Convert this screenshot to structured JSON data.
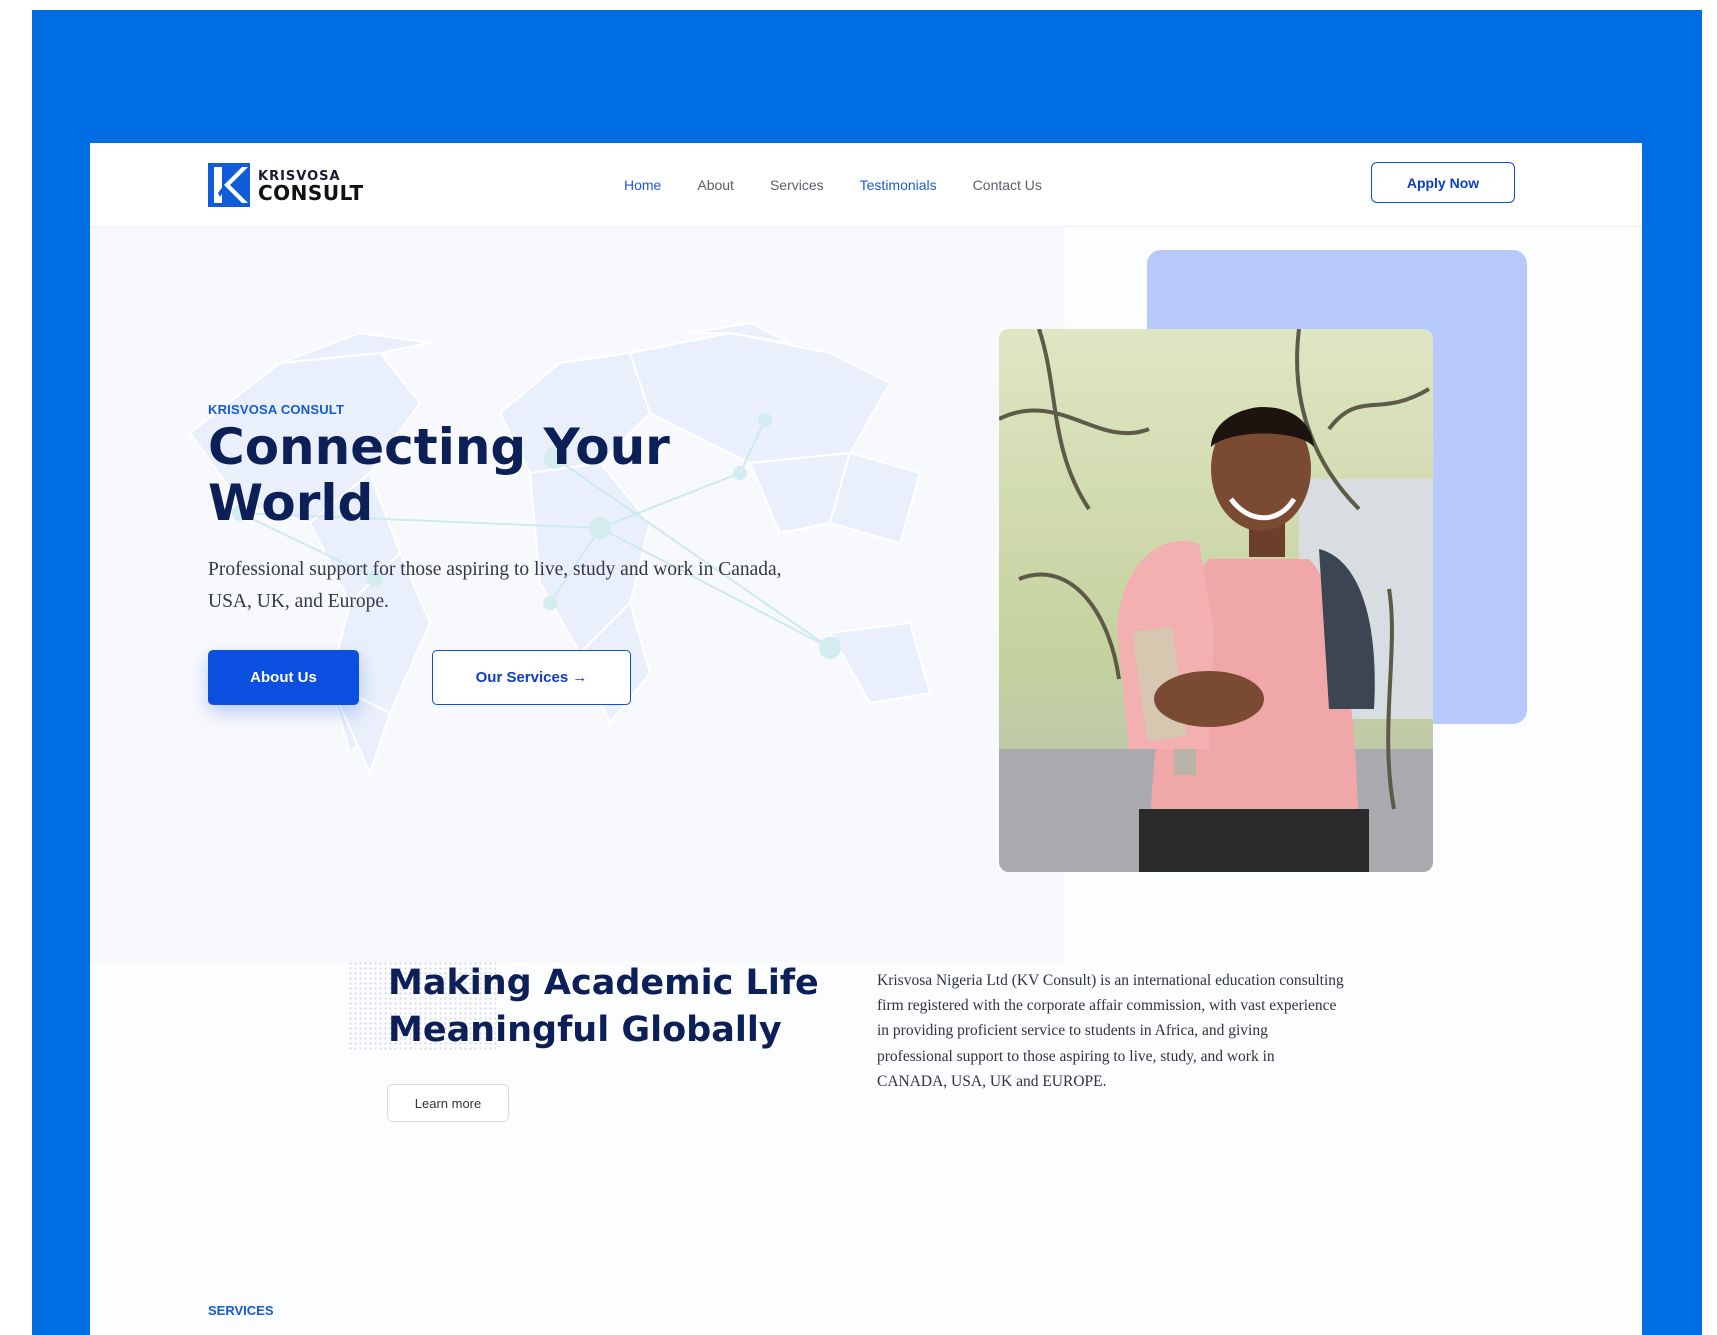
{
  "brand": {
    "logo_line1": "KRISVOSA",
    "logo_line2": "CONSULT"
  },
  "nav": {
    "links": [
      {
        "label": "Home",
        "active": true
      },
      {
        "label": "About",
        "active": false
      },
      {
        "label": "Services",
        "active": false
      },
      {
        "label": "Testimonials",
        "active": true
      },
      {
        "label": "Contact Us",
        "active": false
      }
    ],
    "apply_label": "Apply Now"
  },
  "hero": {
    "eyebrow": "KRISVOSA CONSULT",
    "title": "Connecting Your World",
    "subtitle": "Professional support for those aspiring to live, study and work in Canada, USA, UK, and Europe.",
    "primary_button": "About Us",
    "secondary_button": "Our Services →"
  },
  "about": {
    "title": "Making Academic Life Meaningful Globally",
    "learn_more": "Learn more",
    "paragraph": "Krisvosa Nigeria Ltd (KV Consult) is an international education consulting firm registered with the corporate affair commission, with vast experience in providing proficient service to students in Africa, and giving professional support to those aspiring to live, study, and work in CANADA, USA, UK and EUROPE."
  },
  "services": {
    "eyebrow": "SERVICES"
  },
  "colors": {
    "frame": "#006de2",
    "primary": "#0b4fe0",
    "heading": "#0c1f57",
    "accent_card": "#b7c8fa"
  }
}
